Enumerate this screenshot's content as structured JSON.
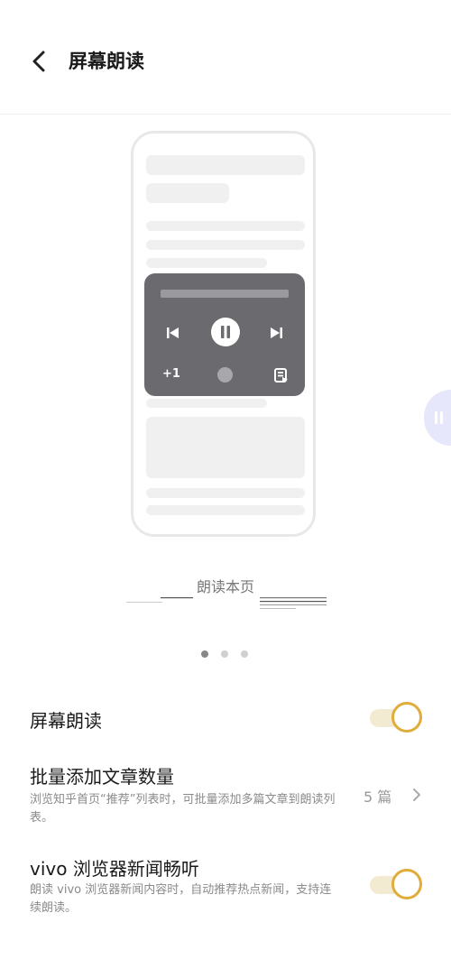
{
  "header": {
    "title": "屏幕朗读",
    "back_icon": "chevron-left-icon"
  },
  "preview": {
    "caption": "朗读本页",
    "page_count": 3,
    "active_page": 1,
    "player": {
      "plus_label": "+1"
    }
  },
  "settings": {
    "screen_read": {
      "title": "屏幕朗读",
      "enabled": true
    },
    "batch_add": {
      "title": "批量添加文章数量",
      "desc": "浏览知乎首页“推荐”列表时，可批量添加多篇文章到朗读列表。",
      "value": "5 篇"
    },
    "vivo_news": {
      "title": "vivo 浏览器新闻畅听",
      "desc": "朗读 vivo 浏览器新闻内容时，自动推荐热点新闻，支持连续朗读。",
      "enabled": true
    }
  },
  "colors": {
    "accent": "#e0ac3a",
    "track": "#f3ead2",
    "player_bg": "#6b6b6f"
  }
}
